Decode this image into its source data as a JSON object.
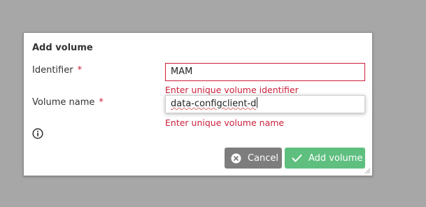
{
  "dialog": {
    "title": "Add volume",
    "identifier": {
      "label": "Identifier",
      "required_mark": "*",
      "value": "MAM",
      "error": "Enter unique volume identifier"
    },
    "volume_name": {
      "label": "Volume name",
      "required_mark": "*",
      "value": "data-configclient-d",
      "error": "Enter unique volume name"
    },
    "buttons": {
      "cancel_label": "Cancel",
      "add_label": "Add volume"
    }
  },
  "colors": {
    "error": "#cc1f3b",
    "cancel_button": "#7d7d7d",
    "add_button": "#5fbf7f",
    "backdrop": "#a7a7a7"
  },
  "icons": {
    "info": "info-icon",
    "cancel": "close-circle-icon",
    "add": "check-icon"
  }
}
